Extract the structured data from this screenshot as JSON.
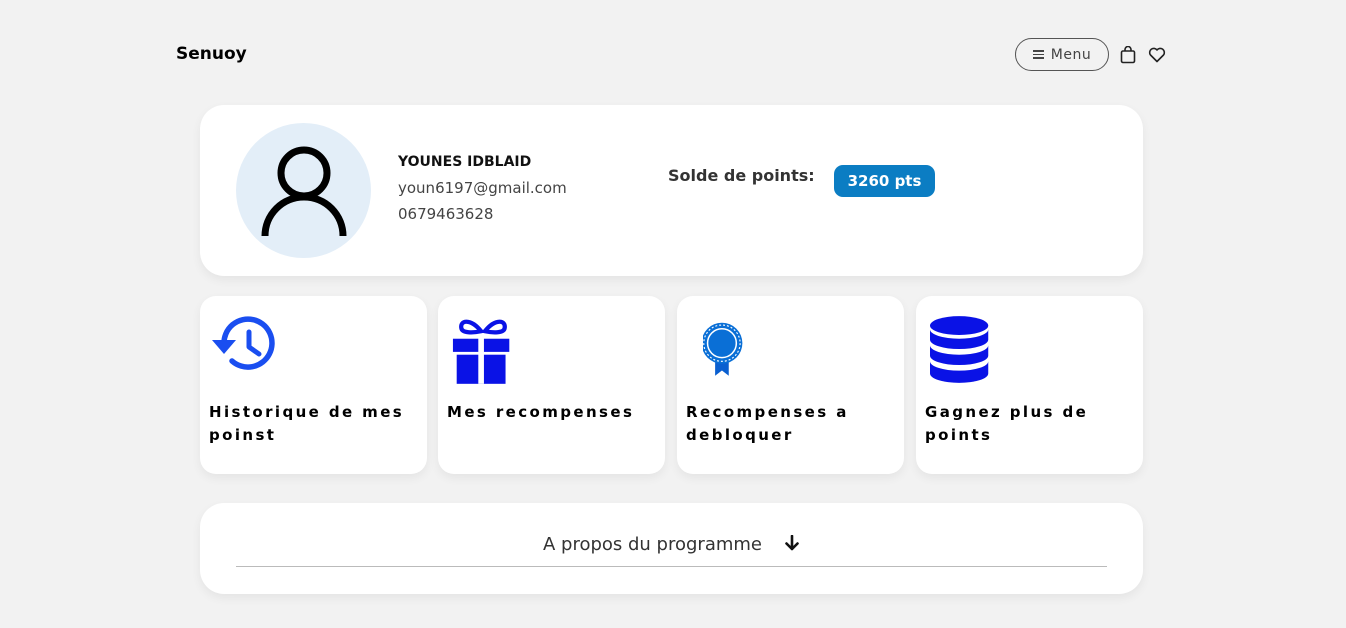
{
  "header": {
    "logo": "Senuoy",
    "menu_label": "Menu",
    "icons": [
      "shopping-bag-icon",
      "heart-icon"
    ]
  },
  "profile": {
    "name": "YOUNES IDBLAID",
    "email": "youn6197@gmail.com",
    "phone": "0679463628",
    "points_label": "Solde de points:",
    "points_value": "3260 pts"
  },
  "tiles": [
    {
      "label": "Historique de mes poinst",
      "icon": "history-icon"
    },
    {
      "label": "Mes recompenses",
      "icon": "gift-icon"
    },
    {
      "label": "Recompenses a debloquer",
      "icon": "award-ribbon-icon"
    },
    {
      "label": "Gagnez plus de points",
      "icon": "database-icon"
    }
  ],
  "about": {
    "label": "A propos du programme"
  },
  "colors": {
    "background": "#f2f2f2",
    "badge": "#0b7dc3",
    "tile_icon_blue": "#0a12e6",
    "history_icon_blue": "#1a4ef0",
    "avatar_bg": "#e3eef8"
  }
}
